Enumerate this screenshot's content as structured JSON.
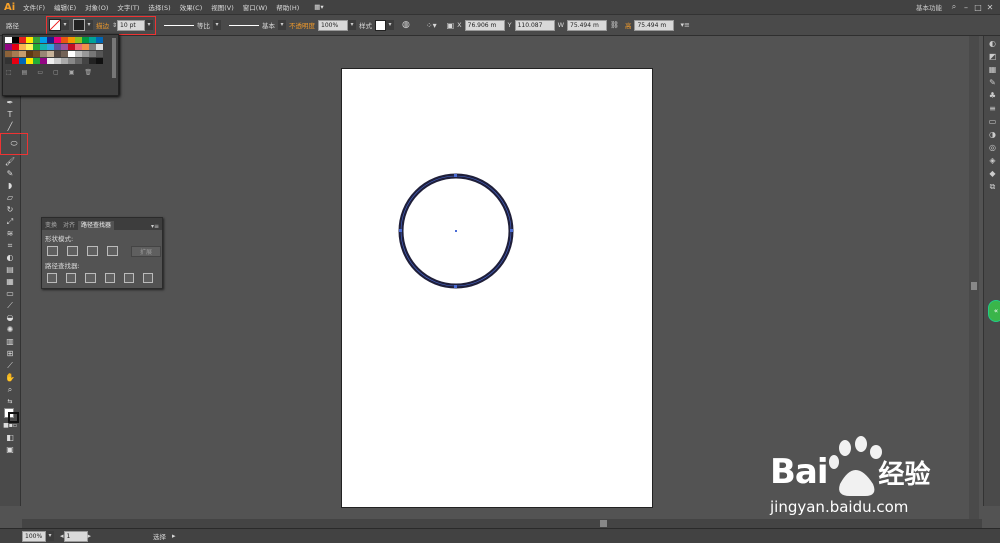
{
  "app": {
    "logo": "Ai"
  },
  "menu": [
    "文件(F)",
    "编辑(E)",
    "对象(O)",
    "文字(T)",
    "选择(S)",
    "效果(C)",
    "视图(V)",
    "窗口(W)",
    "帮助(H)"
  ],
  "workspace": "基本功能",
  "control_bar": {
    "object_type": "路径",
    "stroke_label": "描边",
    "stroke_weight": "10 pt",
    "profile_label": "等比",
    "brush_label": "基本",
    "opacity_label": "不透明度",
    "opacity_value": "100%",
    "style_label": "样式",
    "x_value": "76.906 m",
    "y_value": "110.087",
    "w_value": "75.494 m",
    "h_label": "高",
    "h_value": "75.494 m"
  },
  "pathfinder": {
    "tabs": [
      "变换",
      "对齐",
      "路径查找器"
    ],
    "shape_modes_label": "形状模式:",
    "expand_label": "扩展",
    "pathfinders_label": "路径查找器:"
  },
  "status": {
    "zoom": "100%",
    "page": "1",
    "tool": "选择"
  },
  "watermark": {
    "brand": "Bai",
    "brand2": "经验",
    "url": "jingyan.baidu.com"
  },
  "colors": {
    "accent": "#f7a12a",
    "circle_stroke": "#1f1f3a",
    "highlight": "#e33333"
  }
}
